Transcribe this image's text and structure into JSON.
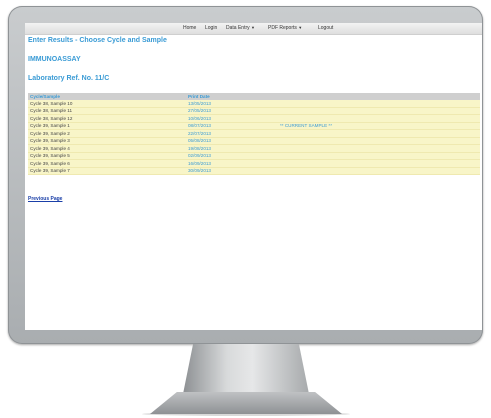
{
  "menu": {
    "home": "Home",
    "login": "Login",
    "data_entry": "Data Entry",
    "pdf_reports": "PDF Reports",
    "logout": "Logout"
  },
  "page": {
    "header": "Enter Results - Choose Cycle and Sample",
    "section": "IMMUNOASSAY",
    "lab_ref": "Laboratory Ref. No. 11/C",
    "previous_page": "Previous Page"
  },
  "table": {
    "headers": [
      "Cycle/Sample",
      "Print Date",
      ""
    ],
    "rows": [
      {
        "sample": "Cycle 38, Sample 10",
        "date": "13/05/2013",
        "note": ""
      },
      {
        "sample": "Cycle 38, Sample 11",
        "date": "27/05/2013",
        "note": ""
      },
      {
        "sample": "Cycle 38, Sample 12",
        "date": "10/06/2013",
        "note": ""
      },
      {
        "sample": "Cycle 39, Sample 1",
        "date": "08/07/2013",
        "note": "** CURRENT SAMPLE **"
      },
      {
        "sample": "Cycle 39, Sample 2",
        "date": "22/07/2013",
        "note": ""
      },
      {
        "sample": "Cycle 39, Sample 3",
        "date": "05/08/2013",
        "note": ""
      },
      {
        "sample": "Cycle 39, Sample 4",
        "date": "19/08/2013",
        "note": ""
      },
      {
        "sample": "Cycle 39, Sample 5",
        "date": "02/09/2013",
        "note": ""
      },
      {
        "sample": "Cycle 39, Sample 6",
        "date": "16/09/2013",
        "note": ""
      },
      {
        "sample": "Cycle 39, Sample 7",
        "date": "30/09/2013",
        "note": ""
      }
    ]
  },
  "colors": {
    "accent": "#3a9bd5",
    "row_bg": "#f8f5c8",
    "link": "#1a3fa8"
  }
}
